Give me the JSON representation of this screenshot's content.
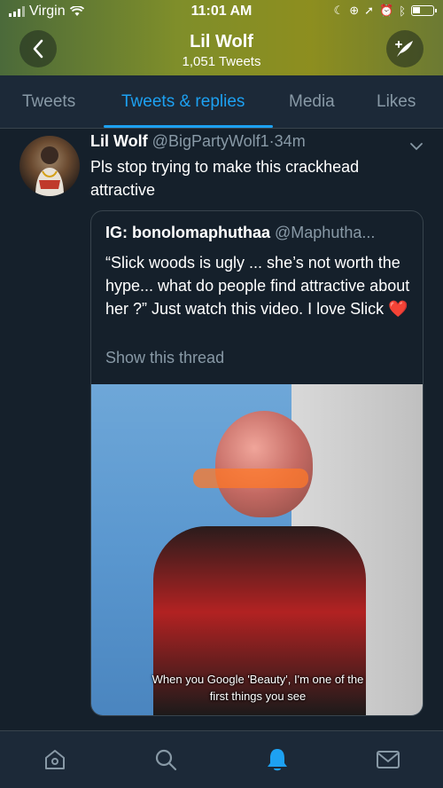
{
  "status_bar": {
    "carrier": "Virgin",
    "time": "11:01 AM"
  },
  "header": {
    "profile_name": "Lil Wolf",
    "tweet_count": "1,051 Tweets",
    "back_icon": "chevron-left-icon",
    "compose_icon": "compose-feather-icon"
  },
  "tabs": [
    {
      "label": "Tweets",
      "active": false
    },
    {
      "label": "Tweets & replies",
      "active": true
    },
    {
      "label": "Media",
      "active": false
    },
    {
      "label": "Likes",
      "active": false
    }
  ],
  "tweet": {
    "author_name": "Lil Wolf",
    "author_handle": "@BigPartyWolf1",
    "time_ago": "34m",
    "text": "Pls stop trying to make this crackhead attractive",
    "quote": {
      "author_name": "IG: bonolomaphuthaa",
      "author_handle": "@Maphutha...",
      "text": "“Slick woods is ugly ... she’s not worth the hype... what do people find attractive about her ?” Just watch this video. I love Slick",
      "emoji": "❤️",
      "show_thread": "Show this thread",
      "media_caption_line1": "When you Google 'Beauty', I'm one of the",
      "media_caption_line2": "first things you see"
    }
  },
  "bottom_nav": [
    {
      "icon": "home-icon",
      "active": false
    },
    {
      "icon": "search-icon",
      "active": false
    },
    {
      "icon": "notifications-bell-icon",
      "active": true
    },
    {
      "icon": "messages-envelope-icon",
      "active": false
    }
  ],
  "colors": {
    "background": "#15202b",
    "accent": "#1da1f2",
    "muted": "#8899a6"
  }
}
